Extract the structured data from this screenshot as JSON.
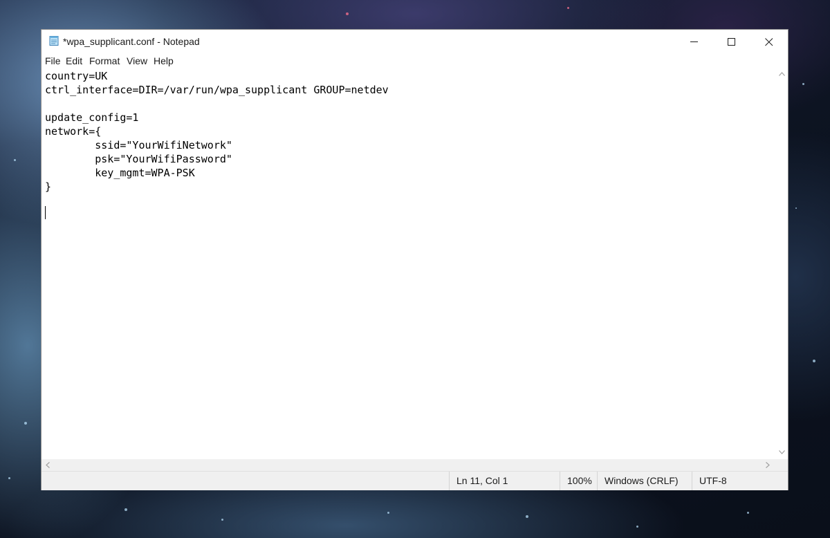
{
  "window": {
    "title": "*wpa_supplicant.conf - Notepad",
    "app_icon": "notepad-icon"
  },
  "menu": {
    "items": [
      "File",
      "Edit",
      "Format",
      "View",
      "Help"
    ]
  },
  "editor": {
    "lines": [
      "country=UK",
      "ctrl_interface=DIR=/var/run/wpa_supplicant GROUP=netdev",
      "",
      "update_config=1",
      "network={",
      "        ssid=\"YourWifiNetwork\"",
      "        psk=\"YourWifiPassword\"",
      "        key_mgmt=WPA-PSK",
      "}",
      "",
      ""
    ]
  },
  "status": {
    "position": "Ln 11, Col 1",
    "zoom": "100%",
    "line_ending": "Windows (CRLF)",
    "encoding": "UTF-8"
  },
  "icons": {
    "minimize": "minimize-icon",
    "maximize": "maximize-icon",
    "close": "close-icon",
    "scroll_up": "chevron-up-icon",
    "scroll_down": "chevron-down-icon",
    "scroll_left": "chevron-left-icon",
    "scroll_right": "chevron-right-icon"
  }
}
